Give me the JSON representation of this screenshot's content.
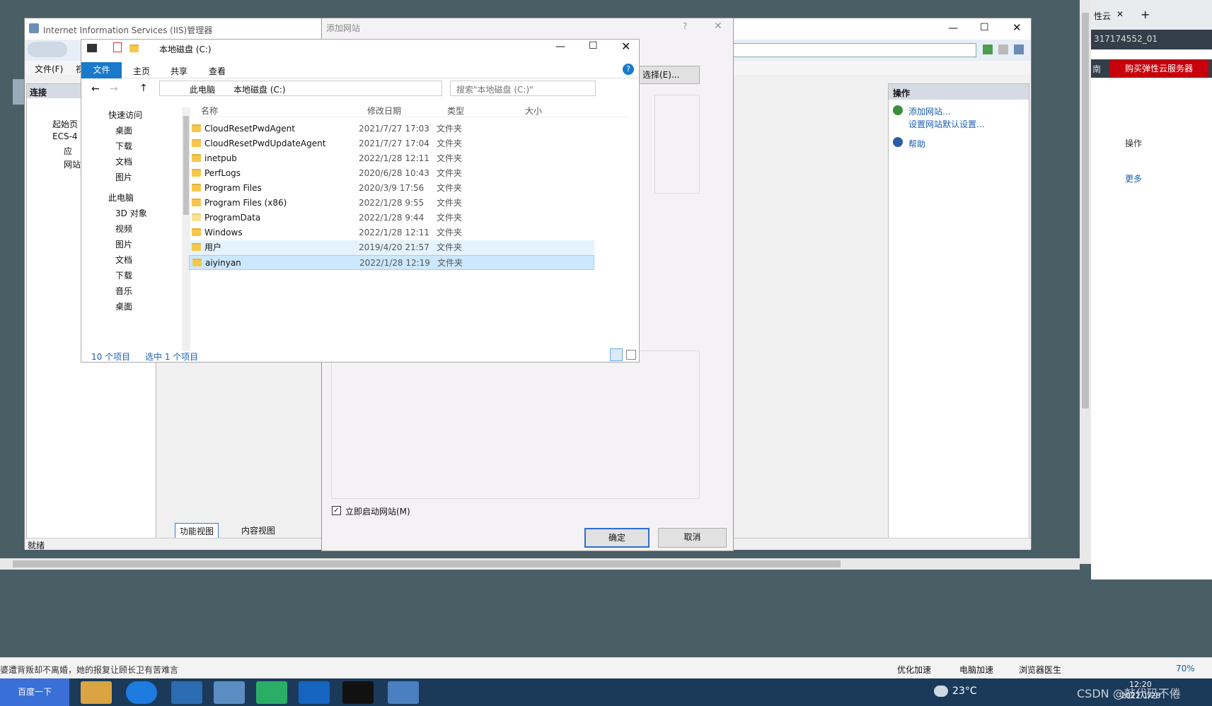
{
  "iis": {
    "title": "Internet Information Services (IIS)管理器",
    "menu_file": "文件(F)",
    "menu_view": "视",
    "connections": "连接",
    "tree": [
      "起始页",
      "ECS-4",
      "应",
      "网站"
    ],
    "actions_title": "操作",
    "add_site": "添加网站...",
    "site_defaults": "设置网站默认设置...",
    "help": "帮助",
    "feature_view": "功能视图",
    "content_view": "内容视图",
    "status": "就绪"
  },
  "add_site": {
    "title": "添加网站",
    "help_glyph": "?",
    "select_button": "选择(E)...",
    "start_now": "立即启动网站(M)",
    "ok": "确定",
    "cancel": "取消"
  },
  "explorer": {
    "title": "本地磁盘 (C:)",
    "ribbon_tabs": [
      "文件",
      "主页",
      "共享",
      "查看"
    ],
    "breadcrumb": [
      "此电脑",
      "本地磁盘 (C:)"
    ],
    "search_placeholder": "搜索\"本地磁盘 (C:)\"",
    "columns": [
      "名称",
      "修改日期",
      "类型",
      "大小"
    ],
    "quick_access": "快速访问",
    "nav": [
      "桌面",
      "下载",
      "文档",
      "图片"
    ],
    "this_pc": "此电脑",
    "pc_items": [
      "3D 对象",
      "视频",
      "图片",
      "文档",
      "下载",
      "音乐",
      "桌面"
    ],
    "files": [
      {
        "name": "CloudResetPwdAgent",
        "date": "2021/7/27 17:03",
        "type": "文件夹"
      },
      {
        "name": "CloudResetPwdUpdateAgent",
        "date": "2021/7/27 17:04",
        "type": "文件夹"
      },
      {
        "name": "inetpub",
        "date": "2022/1/28 12:11",
        "type": "文件夹"
      },
      {
        "name": "PerfLogs",
        "date": "2020/6/28 10:43",
        "type": "文件夹"
      },
      {
        "name": "Program Files",
        "date": "2020/3/9 17:56",
        "type": "文件夹"
      },
      {
        "name": "Program Files (x86)",
        "date": "2022/1/28 9:55",
        "type": "文件夹"
      },
      {
        "name": "ProgramData",
        "date": "2022/1/28 9:44",
        "type": "文件夹"
      },
      {
        "name": "Windows",
        "date": "2022/1/28 12:11",
        "type": "文件夹"
      },
      {
        "name": "用户",
        "date": "2019/4/20 21:57",
        "type": "文件夹"
      },
      {
        "name": "aiyinyan",
        "date": "2022/1/28 12:19",
        "type": "文件夹"
      }
    ],
    "item_count": "10 个项目",
    "selected": "选中 1 个项目"
  },
  "browser": {
    "tab": "性云",
    "instance": "317174552_01",
    "left_hint": "南",
    "buy_button": "购买弹性云服务器",
    "action_col": "操作",
    "more": "更多"
  },
  "status_bar": {
    "news": "婆遭背叛却不离婚，她的报复让顾长卫有苦难言",
    "optimize": "优化加速",
    "pc_speed": "电脑加速",
    "doctor": "浏览器医生",
    "zoom": "70%"
  },
  "taskbar": {
    "search_button": "百度一下",
    "temperature": "23°C",
    "time": "12:20",
    "date": "2022/1/28",
    "watermark": "CSDN @敲代码不倦"
  }
}
